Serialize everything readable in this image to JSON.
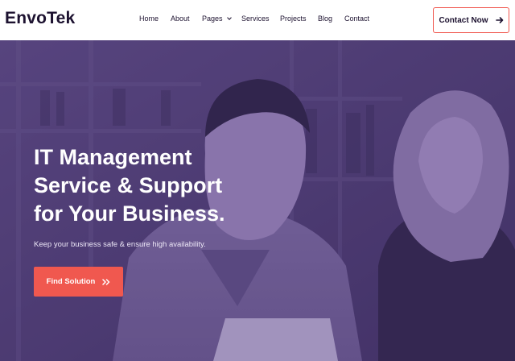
{
  "brand": {
    "logo": "EnvoTek"
  },
  "nav": {
    "items": [
      {
        "label": "Home"
      },
      {
        "label": "About"
      },
      {
        "label": "Pages",
        "dropdown": true
      },
      {
        "label": "Services"
      },
      {
        "label": "Projects"
      },
      {
        "label": "Blog"
      },
      {
        "label": "Contact"
      }
    ]
  },
  "header": {
    "cta_label": "Contact Now",
    "cta_icon": "arrow-right-icon"
  },
  "hero": {
    "title_lines": [
      "IT Management",
      "Service & Support",
      "for Your Business."
    ],
    "subtitle": "Keep your business safe & ensure high availability.",
    "button_label": "Find Solution",
    "button_icon": "double-chevron-right-icon"
  },
  "colors": {
    "accent": "#f0584f",
    "overlay": "#4d3a73",
    "text_dark": "#1d1230"
  }
}
